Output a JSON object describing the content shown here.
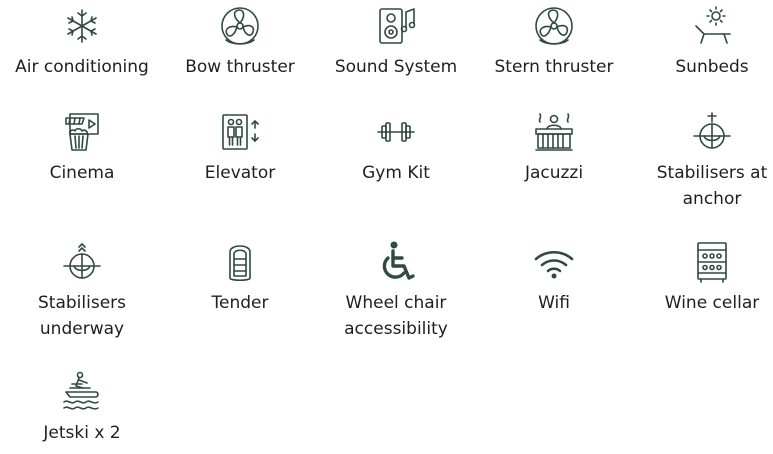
{
  "amenities": {
    "row1": [
      {
        "label": "Air conditioning",
        "icon": "snowflake-icon"
      },
      {
        "label": "Bow thruster",
        "icon": "fan-icon"
      },
      {
        "label": "Sound System",
        "icon": "speaker-icon"
      },
      {
        "label": "Stern thruster",
        "icon": "fan-icon"
      },
      {
        "label": "Sunbeds",
        "icon": "sunbed-icon"
      }
    ],
    "row2": [
      {
        "label": "Cinema",
        "icon": "cinema-icon"
      },
      {
        "label": "Elevator",
        "icon": "elevator-icon"
      },
      {
        "label": "Gym Kit",
        "icon": "dumbbell-icon"
      },
      {
        "label": "Jacuzzi",
        "icon": "jacuzzi-icon"
      },
      {
        "label": "Stabilisers at anchor",
        "icon": "stabiliser-anchor-icon"
      }
    ],
    "row3": [
      {
        "label": "Stabilisers underway",
        "icon": "stabiliser-underway-icon"
      },
      {
        "label": "Tender",
        "icon": "tender-icon"
      },
      {
        "label": "Wheel chair accessibility",
        "icon": "wheelchair-icon"
      },
      {
        "label": "Wifi",
        "icon": "wifi-icon"
      },
      {
        "label": "Wine cellar",
        "icon": "wine-cellar-icon"
      }
    ],
    "row4": [
      {
        "label": "Jetski x 2",
        "icon": "jetski-icon"
      }
    ]
  },
  "colors": {
    "icon": "#2f4a3f",
    "text": "#1f1f1f",
    "background": "#ffffff"
  }
}
